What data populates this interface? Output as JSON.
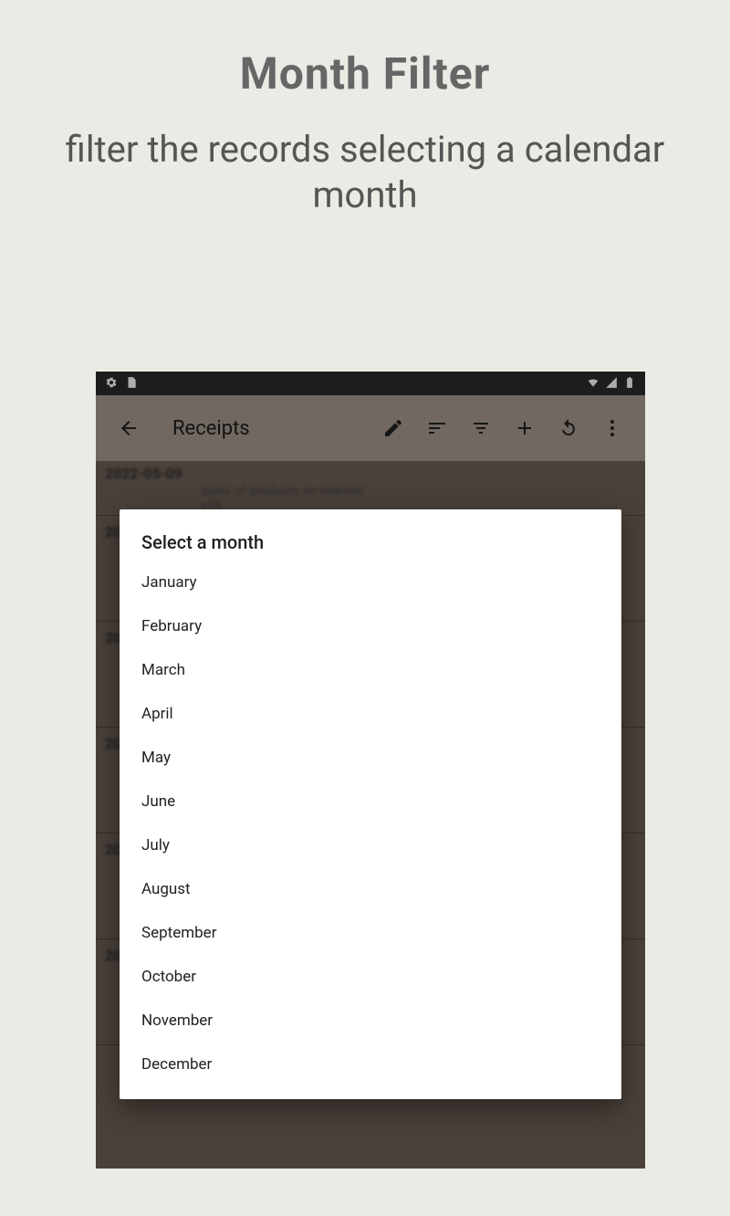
{
  "promo": {
    "title": "Month Filter",
    "subtitle": "filter the records selecting a calendar month"
  },
  "appbar": {
    "title": "Receipts"
  },
  "list": {
    "rows": [
      {
        "date": "2022-05-09",
        "desc": "Sales of products on internet",
        "amt": "+53"
      },
      {
        "date": "20"
      },
      {
        "date": "20"
      },
      {
        "date": "20"
      },
      {
        "date": "20"
      },
      {
        "date": "20"
      }
    ]
  },
  "dialog": {
    "title": "Select a month",
    "items": [
      "January",
      "February",
      "March",
      "April",
      "May",
      "June",
      "July",
      "August",
      "September",
      "October",
      "November",
      "December"
    ]
  }
}
